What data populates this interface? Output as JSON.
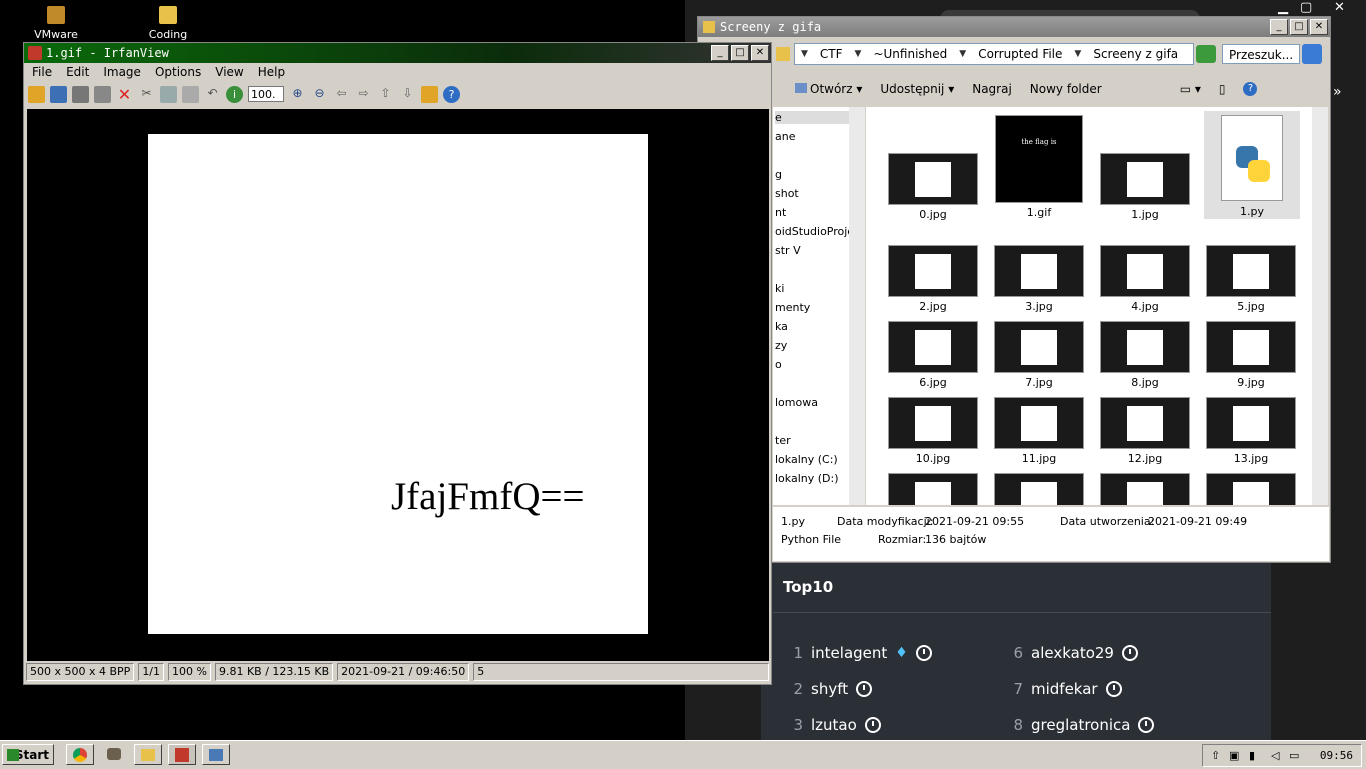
{
  "desktop": {
    "icons": [
      {
        "label": "VMware Workstation"
      },
      {
        "label": "Coding"
      }
    ]
  },
  "top10": {
    "title": "Top10",
    "ranks": [
      {
        "num": "1",
        "name": "intelagent"
      },
      {
        "num": "2",
        "name": "shyft"
      },
      {
        "num": "3",
        "name": "lzutao"
      },
      {
        "num": "6",
        "name": "alexkato29"
      },
      {
        "num": "7",
        "name": "midfekar"
      },
      {
        "num": "8",
        "name": "greglatronica"
      }
    ]
  },
  "explorer": {
    "title": "Screeny z gifa",
    "breadcrumb": [
      "CTF",
      "~Unfinished",
      "Corrupted File",
      "Screeny z gifa"
    ],
    "search_placeholder": "Przeszuk...",
    "commands": [
      "Otwórz",
      "Udostępnij",
      "Nagraj",
      "Nowy folder"
    ],
    "nav_items": [
      "e",
      "ane",
      "g",
      "shot",
      "nt",
      "oidStudioProjec",
      "str V",
      "ki",
      "menty",
      "ka",
      "zy",
      "o",
      "lomowa",
      "ter",
      "lokalny (C:)",
      "lokalny (D:)"
    ],
    "files": [
      "0.jpg",
      "1.gif",
      "1.jpg",
      "1.py",
      "2.jpg",
      "3.jpg",
      "4.jpg",
      "5.jpg",
      "6.jpg",
      "7.jpg",
      "8.jpg",
      "9.jpg",
      "10.jpg",
      "11.jpg",
      "12.jpg",
      "13.jpg"
    ],
    "gif_thumb_text": "the flag is",
    "details": {
      "name": "1.py",
      "type": "Python File",
      "modified_label": "Data modyfikacji:",
      "modified": "2021-09-21 09:55",
      "created_label": "Data utworzenia:",
      "created": "2021-09-21 09:49",
      "size_label": "Rozmiar:",
      "size": "136 bajtów"
    }
  },
  "irfanview": {
    "title": "1.gif - IrfanView",
    "menu": [
      "File",
      "Edit",
      "Image",
      "Options",
      "View",
      "Help"
    ],
    "zoom_value": "100.",
    "image_text": "JfajFmfQ==",
    "status": [
      "500 x 500 x 4 BPP",
      "1/1",
      "100 %",
      "9.81 KB / 123.15 KB",
      "2021-09-21 / 09:46:50",
      "5"
    ]
  },
  "taskbar": {
    "start_label": "Start",
    "clock": "09:56"
  }
}
